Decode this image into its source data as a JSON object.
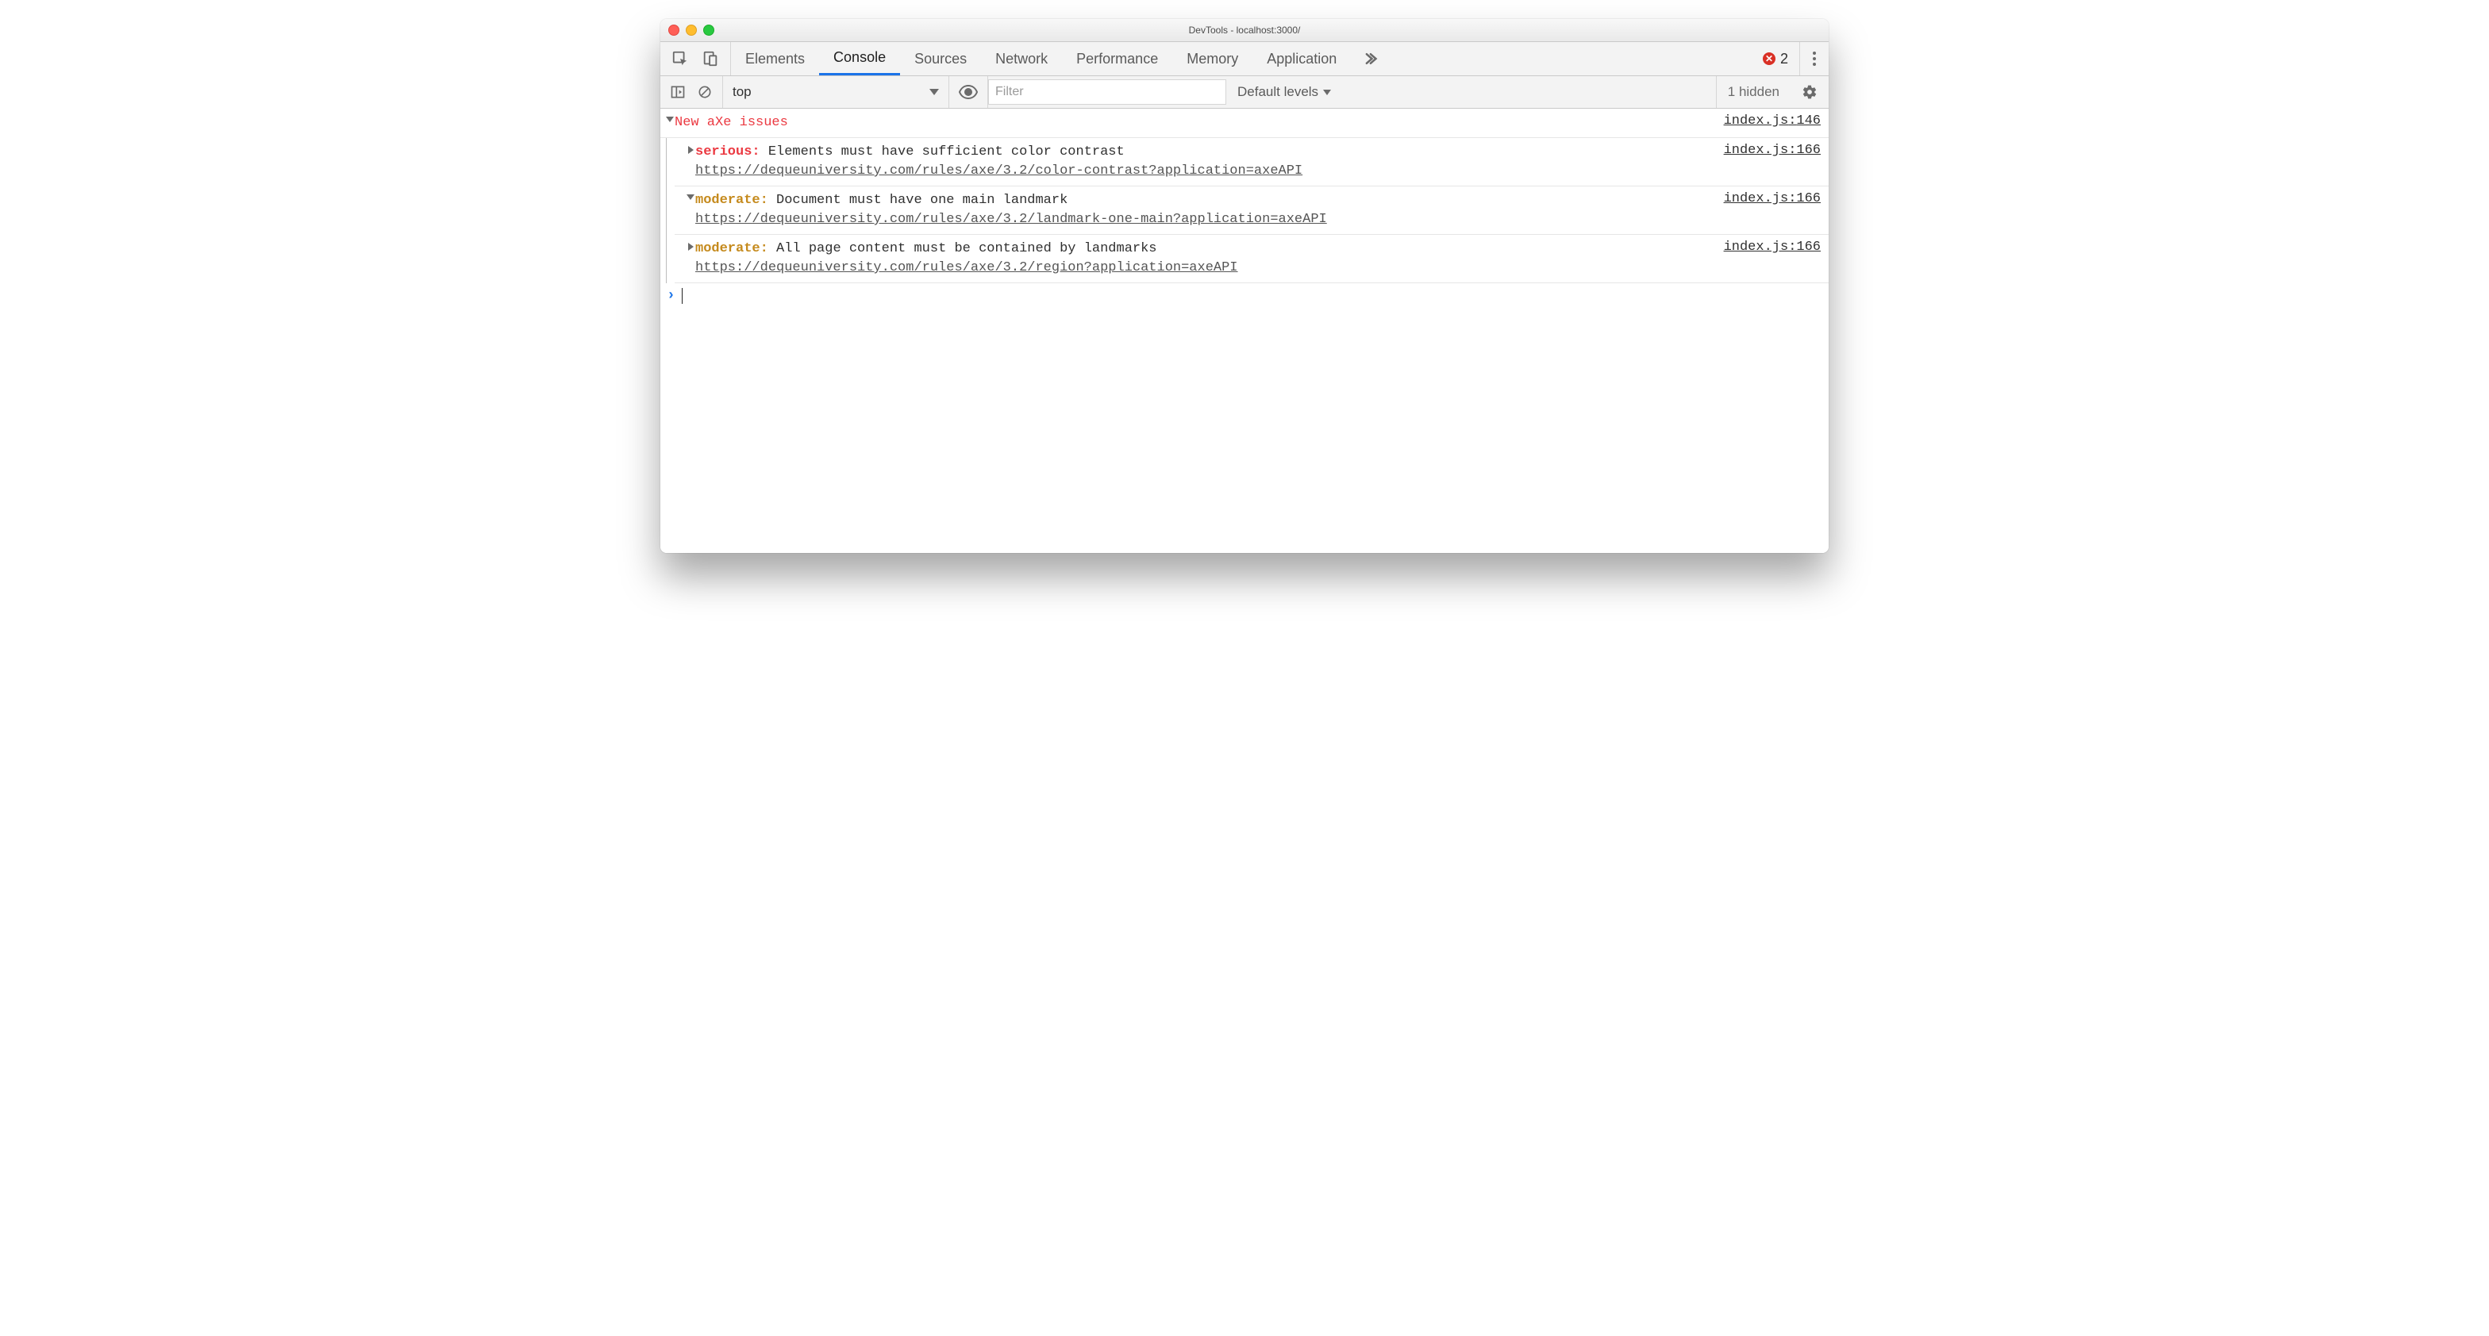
{
  "window": {
    "title": "DevTools - localhost:3000/"
  },
  "tabs": {
    "items": [
      "Elements",
      "Console",
      "Sources",
      "Network",
      "Performance",
      "Memory",
      "Application"
    ],
    "active_index": 1
  },
  "errors": {
    "count": "2"
  },
  "console_toolbar": {
    "context_label": "top",
    "filter_placeholder": "Filter",
    "levels_label": "Default levels",
    "hidden_label": "1 hidden"
  },
  "console": {
    "group": {
      "title": "New aXe issues",
      "source": {
        "file": "index.js",
        "line": "146"
      },
      "expanded": true
    },
    "entries": [
      {
        "expanded": false,
        "severity": "serious",
        "severity_label": "serious:",
        "message": "Elements must have sufficient color contrast",
        "url": "https://dequeuniversity.com/rules/axe/3.2/color-contrast?application=axeAPI",
        "source": {
          "file": "index.js",
          "line": "166"
        }
      },
      {
        "expanded": true,
        "severity": "moderate",
        "severity_label": "moderate:",
        "message": "Document must have one main landmark",
        "url": "https://dequeuniversity.com/rules/axe/3.2/landmark-one-main?application=axeAPI",
        "source": {
          "file": "index.js",
          "line": "166"
        }
      },
      {
        "expanded": false,
        "severity": "moderate",
        "severity_label": "moderate:",
        "message": "All page content must be contained by landmarks",
        "url": "https://dequeuniversity.com/rules/axe/3.2/region?application=axeAPI",
        "source": {
          "file": "index.js",
          "line": "166"
        }
      }
    ]
  }
}
